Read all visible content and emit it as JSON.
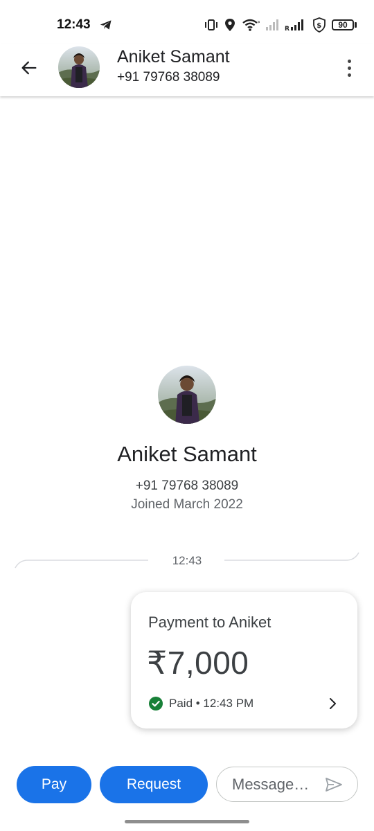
{
  "status_bar": {
    "time": "12:43",
    "battery_level": "90",
    "icons": [
      "telegram-icon",
      "vibrate-icon",
      "location-icon",
      "wifi-icon",
      "signal-icon",
      "roaming-signal-icon",
      "vpn-shield-icon",
      "battery-icon"
    ]
  },
  "header": {
    "contact_name": "Aniket Samant",
    "phone": "+91 79768 38089"
  },
  "profile": {
    "name": "Aniket Samant",
    "phone": "+91 79768 38089",
    "joined": "Joined March 2022"
  },
  "conversation": {
    "timestamp": "12:43",
    "payment": {
      "title": "Payment to Aniket",
      "amount": "₹7,000",
      "status": "Paid • 12:43 PM",
      "status_color": "#188038"
    }
  },
  "actions": {
    "pay_label": "Pay",
    "request_label": "Request",
    "message_placeholder": "Message…"
  },
  "colors": {
    "accent": "#1a73e8",
    "text": "#202124"
  }
}
